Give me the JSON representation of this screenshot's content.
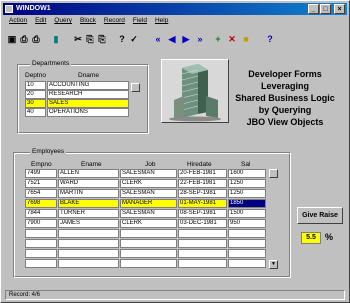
{
  "window": {
    "title": "WINDOW1"
  },
  "menu": [
    "Action",
    "Edit",
    "Query",
    "Block",
    "Record",
    "Field",
    "Help"
  ],
  "toolbar": {
    "icons": [
      "save-icon",
      "print-icon",
      "print-preview-icon",
      "exit-icon",
      "cut-icon",
      "copy-icon",
      "paste-icon",
      "enter-query-icon",
      "execute-query-icon",
      "first-record-icon",
      "previous-record-icon",
      "next-record-icon",
      "last-record-icon",
      "insert-record-icon",
      "delete-record-icon",
      "lock-record-icon",
      "help-icon"
    ],
    "glyphs": [
      "▣",
      "⎙",
      "⎙",
      "▮",
      "✂",
      "⎘",
      "⎘",
      "?",
      "✓",
      "«",
      "◀",
      "▶",
      "»",
      "+",
      "✕",
      "■",
      "?"
    ]
  },
  "departments": {
    "label": "Departments",
    "columns": [
      "Deptno",
      "Dname"
    ],
    "rows": [
      {
        "deptno": "10",
        "dname": "ACCOUNTING"
      },
      {
        "deptno": "20",
        "dname": "RESEARCH"
      },
      {
        "deptno": "30",
        "dname": "SALES"
      },
      {
        "deptno": "40",
        "dname": "OPERATIONS"
      }
    ]
  },
  "heading": {
    "line1": "Developer Forms",
    "line2": "Leveraging",
    "line3": "Shared Business Logic",
    "line4": "by Querying",
    "line5": "JBO View Objects"
  },
  "employees": {
    "label": "Employees",
    "columns": [
      "Empno",
      "Ename",
      "Job",
      "Hiredate",
      "Sal"
    ],
    "rows": [
      {
        "empno": "7499",
        "ename": "ALLEN",
        "job": "SALESMAN",
        "hiredate": "20-FEB-1981",
        "sal": "1600"
      },
      {
        "empno": "7521",
        "ename": "WARD",
        "job": "CLERK",
        "hiredate": "22-FEB-1981",
        "sal": "1250"
      },
      {
        "empno": "7654",
        "ename": "MARTIN",
        "job": "SALESMAN",
        "hiredate": "28-SEP-1981",
        "sal": "1250"
      },
      {
        "empno": "7698",
        "ename": "BLAKE",
        "job": "MANAGER",
        "hiredate": "01-MAY-1981",
        "sal": "1850"
      },
      {
        "empno": "7844",
        "ename": "TURNER",
        "job": "SALESMAN",
        "hiredate": "08-SEP-1981",
        "sal": "1500"
      },
      {
        "empno": "7900",
        "ename": "JAMES",
        "job": "CLERK",
        "hiredate": "03-DEC-1981",
        "sal": "950"
      },
      {
        "empno": "",
        "ename": "",
        "job": "",
        "hiredate": "",
        "sal": ""
      },
      {
        "empno": "",
        "ename": "",
        "job": "",
        "hiredate": "",
        "sal": ""
      },
      {
        "empno": "",
        "ename": "",
        "job": "",
        "hiredate": "",
        "sal": ""
      },
      {
        "empno": "",
        "ename": "",
        "job": "",
        "hiredate": "",
        "sal": ""
      }
    ]
  },
  "raise": {
    "button_label": "Give Raise",
    "value": "5.5",
    "unit": "%"
  },
  "status": {
    "text": "Record: 4/6"
  },
  "colors": {
    "selected_row": "#ffff00",
    "focused_cell": "#000080",
    "titlebar": "#000080"
  }
}
